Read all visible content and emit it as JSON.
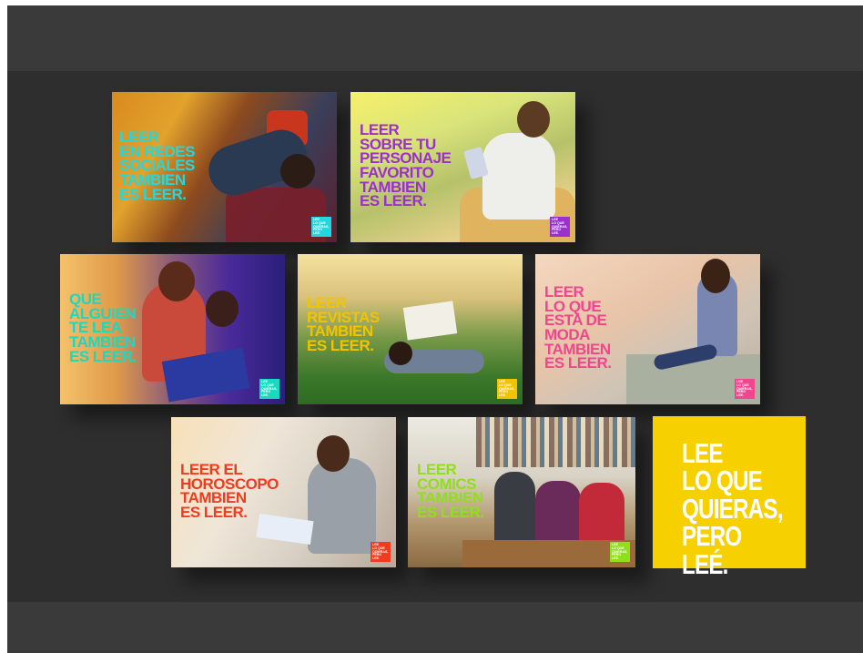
{
  "posters": [
    {
      "headline": "LEER\nEN REDES\nSOCIALES\nTAMBIEN\nES LEER.",
      "badge": "LEE\nLO QUE\nQUIERAS,\nPERO LEE.",
      "accent": "#22d8e0"
    },
    {
      "headline": "LEER\nSOBRE TU\nPERSONAJE\nFAVORITO\nTAMBIEN\nES LEER.",
      "badge": "LEE\nLO QUE\nQUIERAS,\nPERO LEE.",
      "accent": "#9b2fd0"
    },
    {
      "headline": "QUE\nALGUIEN\nTE LEA\nTAMBIEN\nES LEER.",
      "badge": "LEE\nLO QUE\nQUIERAS,\nPERO LEE.",
      "accent": "#19d9c0"
    },
    {
      "headline": "LEER\nREVISTAS\nTAMBIEN\nES LEER.",
      "badge": "LEE\nLO QUE\nQUIERAS,\nPERO LEE.",
      "accent": "#f2c400"
    },
    {
      "headline": "LEER\nLO QUE\nESTA DE\nMODA\nTAMBIEN\nES LEER.",
      "badge": "LEE\nLO QUE\nQUIERAS,\nPERO LEE.",
      "accent": "#f0468e"
    },
    {
      "headline": "LEER EL\nHOROSCOPO\nTAMBIEN\nES LEER.",
      "badge": "LEE\nLO QUE\nQUIERAS,\nPERO LEE.",
      "accent": "#f23a1c"
    },
    {
      "headline": "LEER\nCOMICS\nTAMBIEN\nES LEER.",
      "badge": "LEE\nLO QUE\nQUIERAS,\nPERO LEE.",
      "accent": "#8fe01a"
    }
  ],
  "final_card": {
    "text": "LEE\nLO QUE\nQUIERAS,\nPERO LEÉ.",
    "color": "#f7d000"
  }
}
